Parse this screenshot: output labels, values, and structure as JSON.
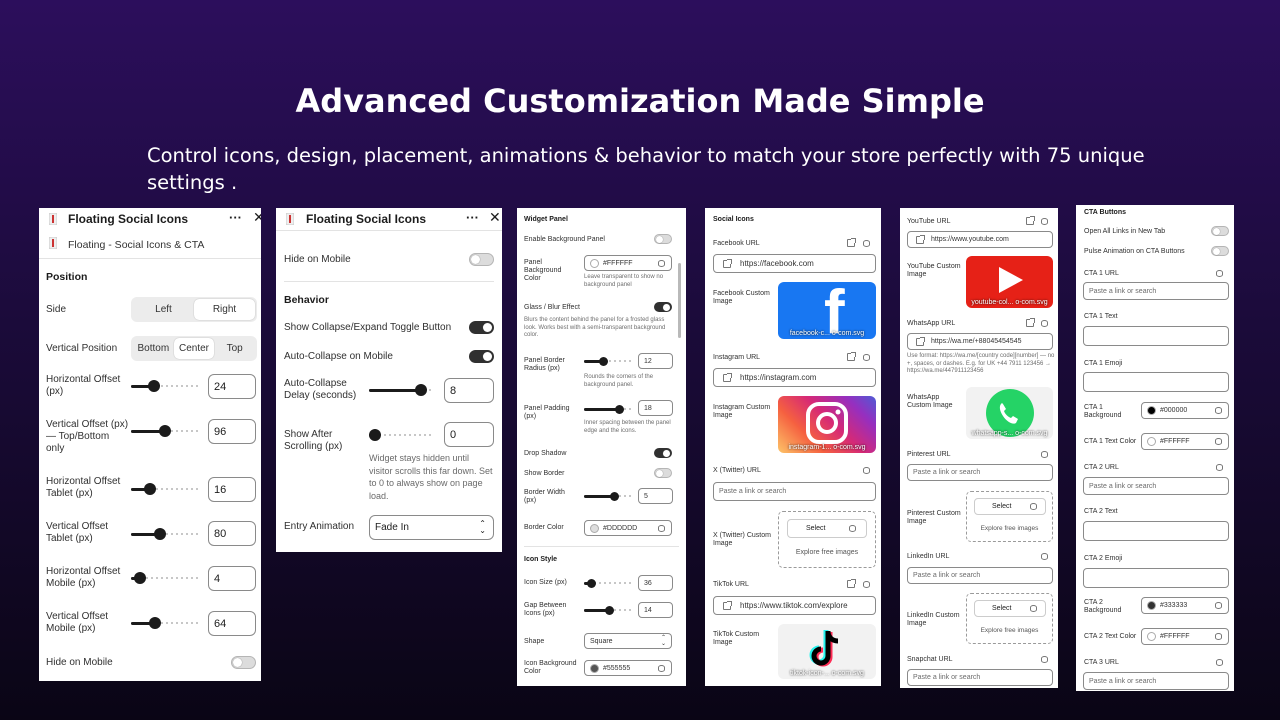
{
  "hero": {
    "title": "Advanced Customization Made Simple",
    "subtitle": "Control icons, design, placement, animations & behavior to match your store perfectly with 75 unique settings ."
  },
  "p1": {
    "app_title": "Floating Social Icons",
    "sub_title": "Floating - Social Icons & CTA",
    "section": "Position",
    "side_label": "Side",
    "side_opts": [
      "Left",
      "Right"
    ],
    "vpos_label": "Vertical Position",
    "vpos_opts": [
      "Bottom",
      "Center",
      "Top"
    ],
    "rows": [
      {
        "label": "Horizontal Offset (px)",
        "value": "24"
      },
      {
        "label": "Vertical Offset (px) — Top/Bottom only",
        "value": "96"
      },
      {
        "label": "Horizontal Offset Tablet (px)",
        "value": "16"
      },
      {
        "label": "Vertical Offset Tablet (px)",
        "value": "80"
      },
      {
        "label": "Horizontal Offset Mobile (px)",
        "value": "4"
      },
      {
        "label": "Vertical Offset Mobile (px)",
        "value": "64"
      }
    ],
    "hide_mobile": "Hide on Mobile"
  },
  "p2": {
    "app_title": "Floating Social Icons",
    "hide_mobile": "Hide on Mobile",
    "section": "Behavior",
    "show_toggle": "Show Collapse/Expand Toggle Button",
    "auto_collapse": "Auto-Collapse on Mobile",
    "delay_label": "Auto-Collapse Delay (seconds)",
    "delay_value": "8",
    "after_label": "Show After Scrolling (px)",
    "after_value": "0",
    "after_hint": "Widget stays hidden until visitor scrolls this far down. Set to 0 to always show on page load.",
    "anim_label": "Entry Animation",
    "anim_value": "Fade In"
  },
  "p3": {
    "section": "Widget Panel",
    "enable_bg": "Enable Background Panel",
    "panel_bg_label": "Panel Background Color",
    "panel_bg_value": "#FFFFFF",
    "panel_bg_hint": "Leave transparent to show no background panel",
    "glass_label": "Glass / Blur Effect",
    "glass_hint": "Blurs the content behind the panel for a frosted glass look. Works best with a semi-transparent background color.",
    "radius_label": "Panel Border Radius (px)",
    "radius_value": "12",
    "radius_hint": "Rounds the corners of the background panel.",
    "padding_label": "Panel Padding (px)",
    "padding_value": "18",
    "padding_hint": "Inner spacing between the panel edge and the icons.",
    "drop_shadow": "Drop Shadow",
    "show_border": "Show Border",
    "border_width_label": "Border Width (px)",
    "border_width_value": "5",
    "border_color_label": "Border Color",
    "border_color_value": "#DDDDDD",
    "section2": "Icon Style",
    "icon_size_label": "Icon Size (px)",
    "icon_size_value": "36",
    "gap_label": "Gap Between Icons (px)",
    "gap_value": "14",
    "shape_label": "Shape",
    "shape_value": "Square",
    "icon_bg_label": "Icon Background Color",
    "icon_bg_value": "#555555"
  },
  "p4": {
    "section": "Social Icons",
    "fb_label": "Facebook URL",
    "fb_value": "https://facebook.com",
    "fb_img_label": "Facebook Custom Image",
    "fb_img_cap": "facebook-c... o-com.svg",
    "ig_label": "Instagram URL",
    "ig_value": "https://instagram.com",
    "ig_img_label": "Instagram Custom Image",
    "ig_img_cap": "instagram-1... o-com.svg",
    "x_label": "X (Twitter) URL",
    "x_placeholder": "Paste a link or search",
    "x_img_label": "X (Twitter) Custom Image",
    "select": "Select",
    "explore": "Explore free images",
    "tt_label": "TikTok URL",
    "tt_value": "https://www.tiktok.com/explore",
    "tt_img_label": "TikTok Custom Image",
    "tt_img_cap": "tiktok-icon-... o-com.svg"
  },
  "p5": {
    "yt_label": "YouTube URL",
    "yt_value": "https://www.youtube.com",
    "yt_img_label": "YouTube Custom Image",
    "yt_img_cap": "youtube-col... o-com.svg",
    "wa_label": "WhatsApp URL",
    "wa_value": "https://wa.me/+88045454545",
    "wa_hint": "Use format: https://wa.me/[country code][number] — no +, spaces, or dashes. E.g. for UK +44 7911 123456 → https://wa.me/447911123456",
    "wa_img_label": "WhatsApp Custom Image",
    "wa_img_cap": "whatsapp-s... o-com.svg",
    "pin_label": "Pinterest URL",
    "placeholder": "Paste a link or search",
    "pin_img_label": "Pinterest Custom Image",
    "select": "Select",
    "explore": "Explore free images",
    "li_label": "LinkedIn URL",
    "li_img_label": "LinkedIn Custom Image",
    "sc_label": "Snapchat URL"
  },
  "p6": {
    "section": "CTA Buttons",
    "open_links": "Open All Links in New Tab",
    "pulse": "Pulse Animation on CTA Buttons",
    "placeholder": "Paste a link or search",
    "cta1_url": "CTA 1 URL",
    "cta1_text": "CTA 1 Text",
    "cta1_emoji": "CTA 1 Emoji",
    "cta1_bg": "CTA 1 Background",
    "cta1_bg_value": "#000000",
    "cta1_tc": "CTA 1 Text Color",
    "cta1_tc_value": "#FFFFFF",
    "cta2_url": "CTA 2 URL",
    "cta2_text": "CTA 2 Text",
    "cta2_emoji": "CTA 2 Emoji",
    "cta2_bg": "CTA 2 Background",
    "cta2_bg_value": "#333333",
    "cta2_tc": "CTA 2 Text Color",
    "cta2_tc_value": "#FFFFFF",
    "cta3_url": "CTA 3 URL"
  },
  "colors": {
    "accent": "#1b1b1b",
    "bg_top": "#2c0e5c",
    "bg_bottom": "#0a0515",
    "youtube": "#e62117",
    "whatsapp": "#25d366",
    "facebook": "#1877f2"
  }
}
